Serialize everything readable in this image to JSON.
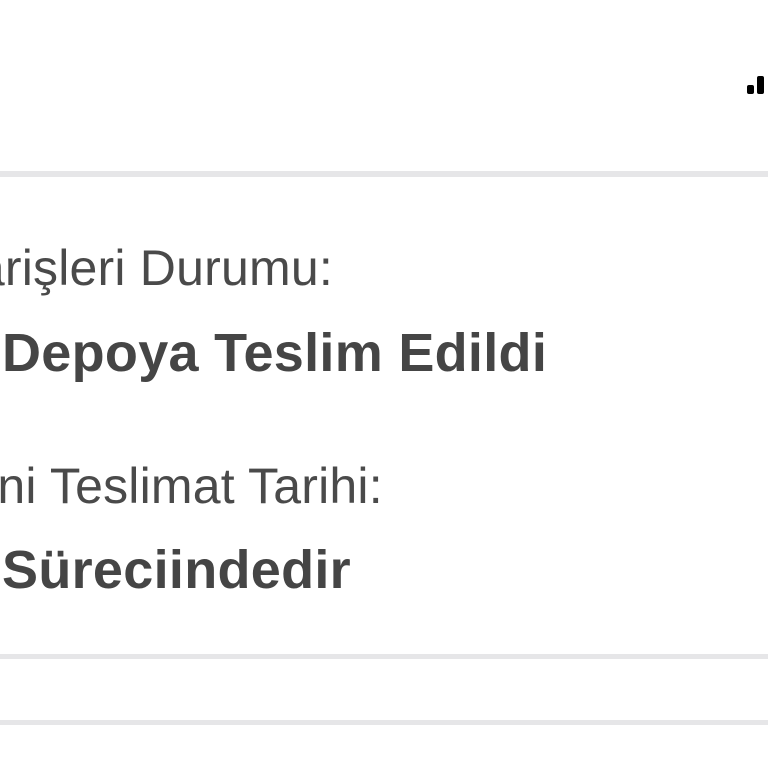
{
  "delivery": {
    "status_label": "Siparişleri Durumu:",
    "status_value": "Depoya Teslim Edildi",
    "date_label": "Tahmini Teslimat Tarihi:",
    "date_value": "Süreciindedir"
  },
  "colors": {
    "label_text": "#4a4a4a",
    "value_text": "#454545",
    "divider": "#e6e6e8",
    "background": "#ffffff"
  },
  "status_bar": {
    "signal_icon": "cellular-signal-icon"
  }
}
